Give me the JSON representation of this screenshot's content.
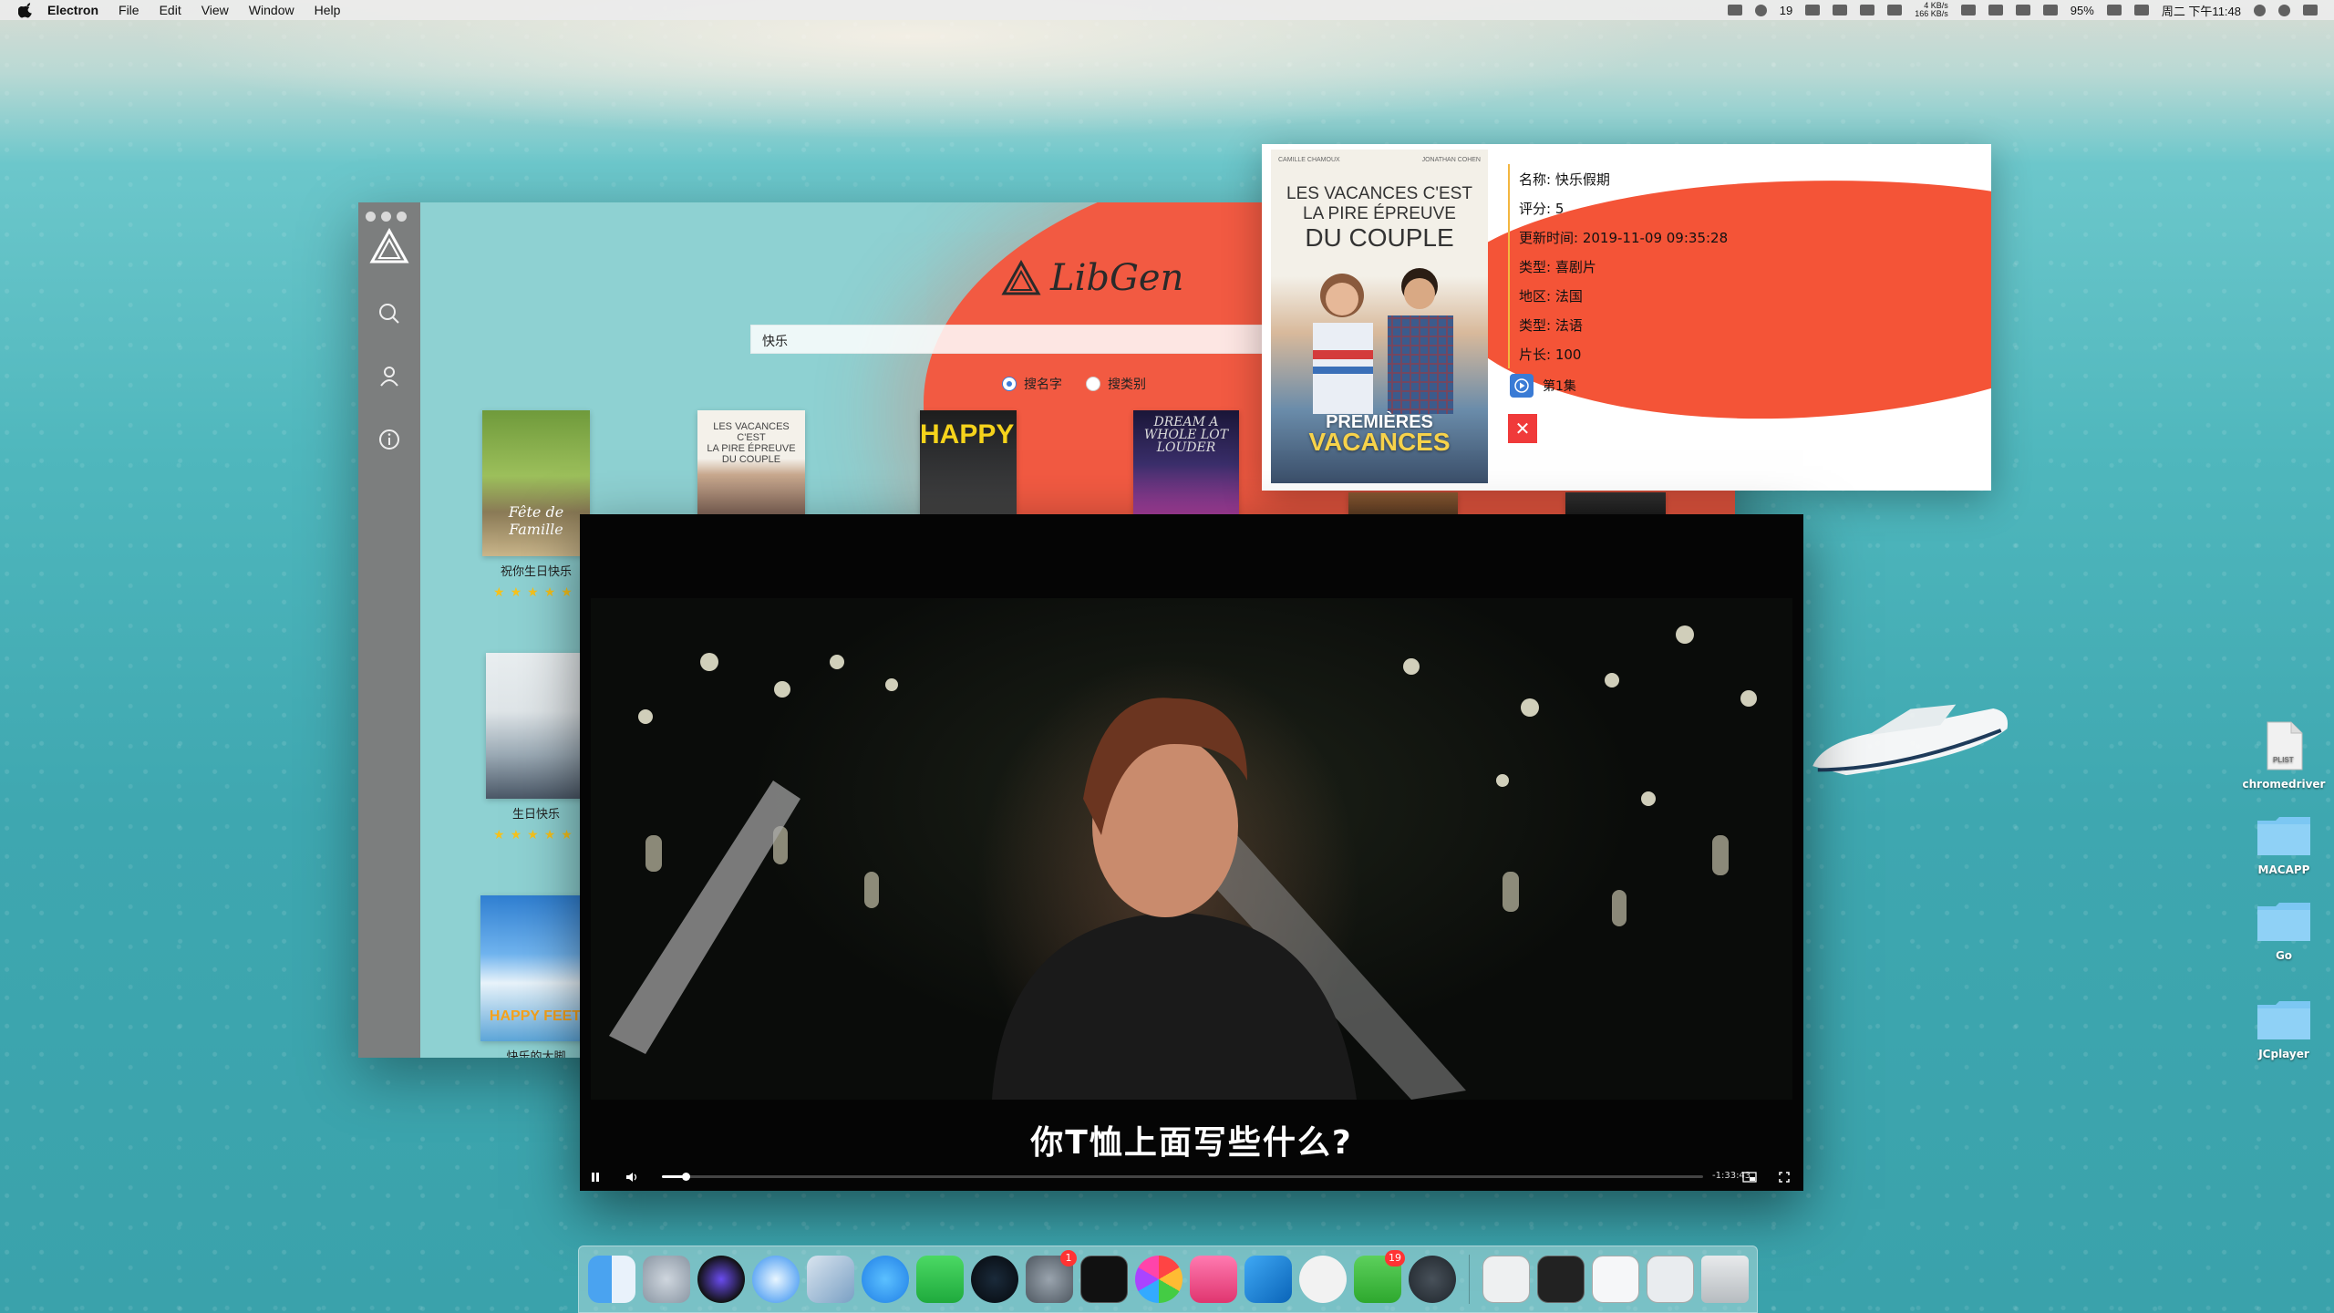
{
  "menubar": {
    "app_name": "Electron",
    "menus": [
      "File",
      "Edit",
      "View",
      "Window",
      "Help"
    ],
    "status": {
      "wechat_count": "19",
      "net_up": "4 KB/s",
      "net_down": "166 KB/s",
      "battery": "95%",
      "clock": "周二 下午11:48"
    }
  },
  "app": {
    "brand": "LibGen",
    "search_value": "快乐",
    "radio_by_name": "搜名字",
    "radio_by_category": "搜类别",
    "posters": [
      {
        "caption": "祝你生日快乐",
        "rating_stars": 5
      },
      {
        "caption": "生日快乐",
        "rating_stars": 5
      },
      {
        "caption": "快乐的大脚"
      }
    ]
  },
  "detail": {
    "name": "名称: 快乐假期",
    "rating": "评分: 5",
    "updated": "更新时间: 2019-11-09 09:35:28",
    "type": "类型: 喜剧片",
    "region": "地区: 法国",
    "language": "类型: 法语",
    "length": "片长: 100",
    "episode": "第1集",
    "close": "✕",
    "poster": {
      "actor_left": "CAMILLE CHAMOUX",
      "actor_right": "JONATHAN COHEN",
      "tagline_1": "LES VACANCES C'EST",
      "tagline_2": "LA PIRE ÉPREUVE",
      "tagline_3": "DU COUPLE",
      "title_1": "PREMIÈRES",
      "title_2": "VACANCES"
    }
  },
  "player": {
    "subtitle": "你T恤上面写些什么?",
    "time_remaining": "-1:33:43",
    "progress": 0.023
  },
  "desktop_icons": [
    {
      "label": "chromedriver",
      "kind": "PLIST"
    },
    {
      "label": "MACAPP"
    },
    {
      "label": "Go"
    },
    {
      "label": "JCplayer"
    }
  ],
  "dock": {
    "badges": {
      "system_prefs": "1",
      "wechat": "19"
    }
  },
  "colors": {
    "accent_red": "#f25a42",
    "app_teal": "#8ed1d2",
    "sidebar_gray": "#7c7e7e",
    "star_yellow": "#f6c21b"
  }
}
